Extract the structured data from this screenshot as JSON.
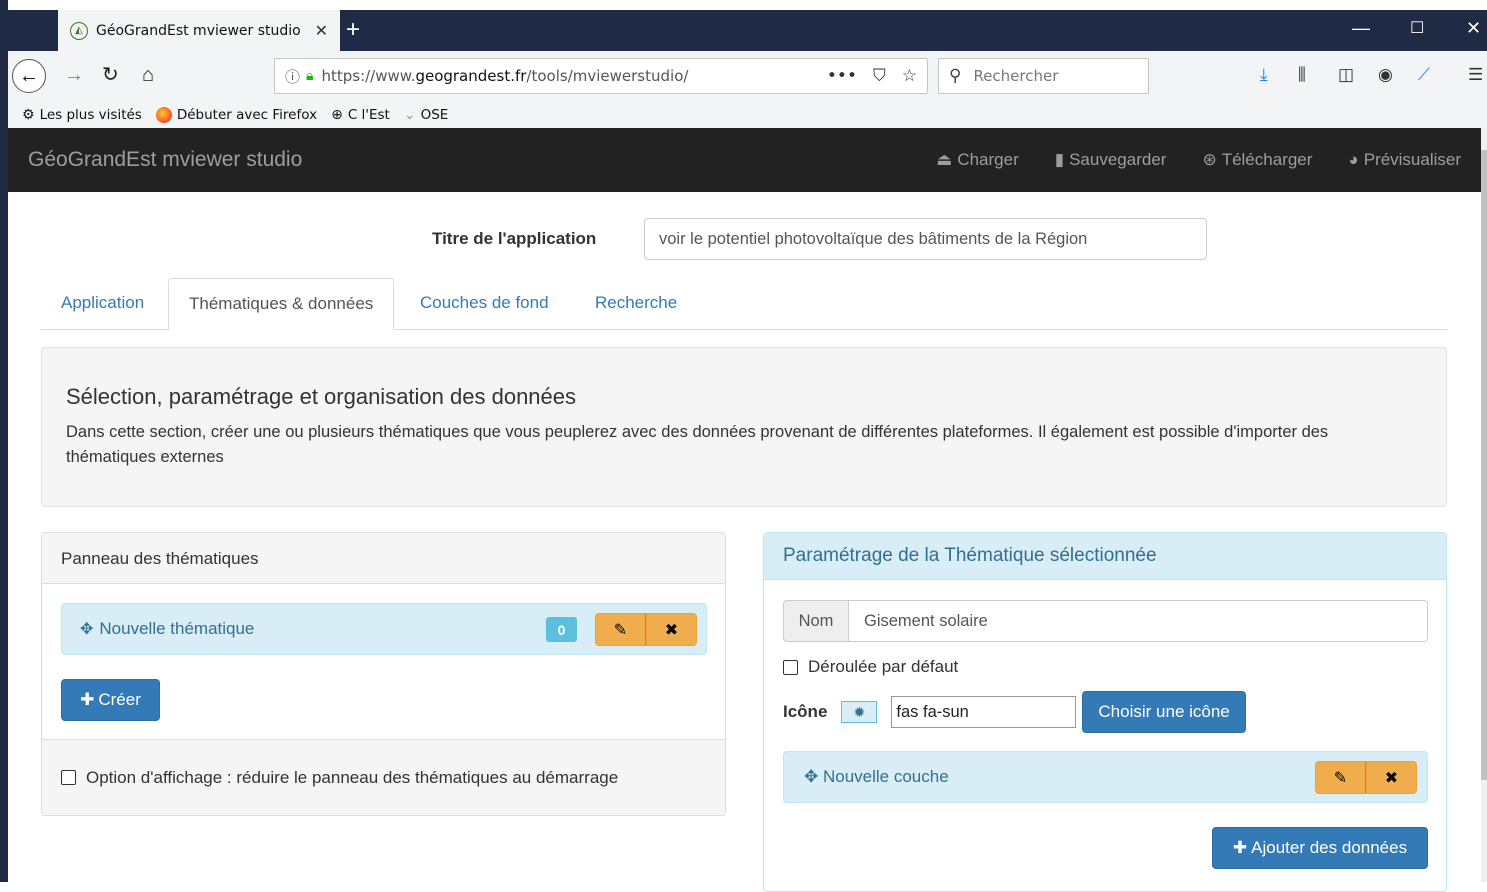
{
  "browser": {
    "tab_title": "GéoGrandEst mviewer studio",
    "tab_close": "✕",
    "new_tab": "+",
    "url_prefix": "https://www.",
    "url_domain": "geograndest.fr",
    "url_path": "/tools/mviewerstudio/",
    "search_placeholder": "Rechercher",
    "bookmarks": [
      "Les plus visités",
      "Débuter avec Firefox",
      "C l'Est",
      "OSE"
    ]
  },
  "app": {
    "brand": "GéoGrandEst mviewer studio",
    "nav": [
      "Charger",
      "Sauvegarder",
      "Télécharger",
      "Prévisualiser"
    ],
    "title_label": "Titre de l'application",
    "title_value": "voir le potentiel photovoltaïque des bâtiments de la Région",
    "tabs": [
      "Application",
      "Thématiques & données",
      "Couches de fond",
      "Recherche"
    ],
    "active_tab": "Thématiques & données",
    "section_heading": "Sélection, paramétrage et organisation des données",
    "section_text": "Dans cette section, créer une ou plusieurs thématiques que vous peuplerez avec des données provenant de différentes plateformes. Il également est possible d'importer des thématiques externes"
  },
  "left_panel": {
    "heading": "Panneau des thématiques",
    "theme_label": "Nouvelle thématique",
    "theme_count": "0",
    "create_label": "Créer",
    "option_label": "Option d'affichage : réduire le panneau des thématiques au démarrage",
    "option_checked": false
  },
  "right_panel": {
    "heading": "Paramétrage de la Thématique sélectionnée",
    "nom_label": "Nom",
    "nom_value": "Gisement solaire",
    "deroule_label": "Déroulée par défaut",
    "deroule_checked": false,
    "icone_label": "Icône",
    "icone_value": "fas fa-sun",
    "choose_icon_label": "Choisir une icône",
    "layer_label": "Nouvelle couche",
    "add_data_label": "Ajouter des données"
  },
  "colors": {
    "primary": "#337ab7",
    "warning": "#f0ad4e",
    "info_bg": "#d9edf7",
    "info_text": "#31708f",
    "navbar": "#222222"
  }
}
